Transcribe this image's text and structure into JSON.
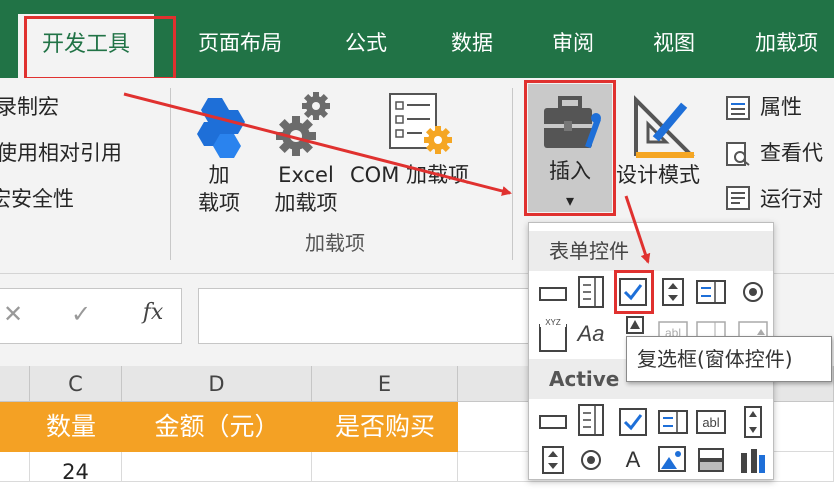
{
  "tabs": [
    {
      "label": "开发工具",
      "active": true
    },
    {
      "label": "页面布局"
    },
    {
      "label": "公式"
    },
    {
      "label": "数据"
    },
    {
      "label": "审阅"
    },
    {
      "label": "视图"
    },
    {
      "label": "加载项"
    }
  ],
  "ribbon": {
    "code_group": {
      "record_macro": "录制宏",
      "relative_ref": "使用相对引用",
      "macro_security": "宏安全性"
    },
    "addins_group": {
      "addins_label_1": "加",
      "addins_label_2": "载项",
      "excel_label_1": "Excel",
      "excel_label_2": "加载项",
      "com_label": "COM 加载项",
      "group_label": "加载项"
    },
    "controls_group": {
      "insert_label": "插入",
      "insert_arrow": "▾",
      "design_mode": "设计模式",
      "properties": "属性",
      "view_code": "查看代",
      "run_dialog": "运行对"
    }
  },
  "formula_bar": {
    "cancel_glyph": "✕",
    "enter_glyph": "✓",
    "fx_glyph": "fx",
    "value": ""
  },
  "grid": {
    "columns": [
      "C",
      "D",
      "E"
    ],
    "header_cells": [
      "数量",
      "金额（元）",
      "是否购买"
    ],
    "row_value": "24"
  },
  "dropdown": {
    "form_controls_title": "表单控件",
    "activex_title": "Active",
    "textbox_glyph": "abl",
    "label_glyph": "Aa",
    "a_glyph": "A",
    "xyz_glyph": "XYZ"
  },
  "tooltip": {
    "text": "复选框(窗体控件)"
  },
  "colors": {
    "ribbon_green": "#217346",
    "highlight_red": "#e0312f",
    "header_orange": "#f4a124",
    "icon_blue": "#1e6fd8",
    "gear_orange": "#f5a623"
  }
}
